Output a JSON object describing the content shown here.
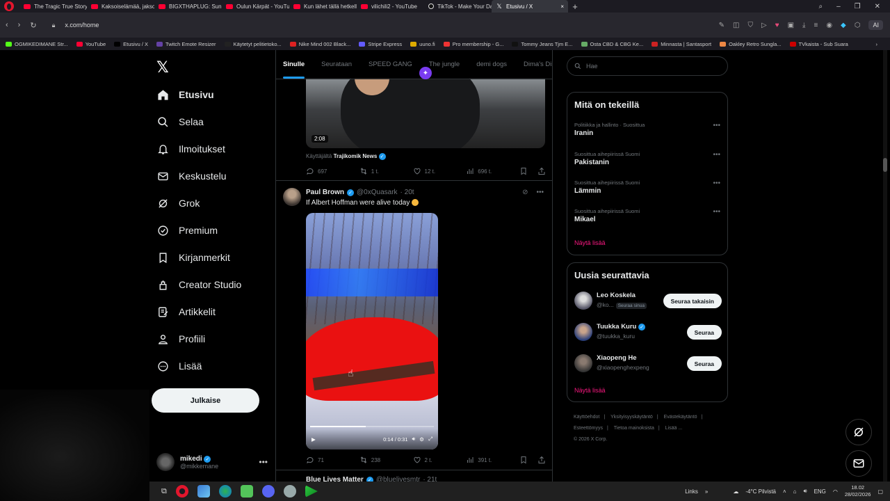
{
  "browser": {
    "tabs": [
      {
        "label": "The Tragic True Story of Ju",
        "icon": "youtube-icon"
      },
      {
        "label": "Kaksoiselämää, jakso 4 - Y",
        "icon": "youtube-icon"
      },
      {
        "label": "BIGXTHAPLUG: Sundae C",
        "icon": "youtube-icon"
      },
      {
        "label": "Oulun Kärpät - YouTube",
        "icon": "youtube-icon"
      },
      {
        "label": "Kun lähet tällä hetkellä uli",
        "icon": "youtube-icon"
      },
      {
        "label": "vilichili2 - YouTube",
        "icon": "youtube-icon"
      },
      {
        "label": "TikTok - Make Your Day",
        "icon": "tiktok-icon"
      },
      {
        "label": "Etusivu / X",
        "icon": "x-icon",
        "active": true
      }
    ],
    "url": "x.com/home",
    "ai_button": "AI",
    "bookmarks": [
      {
        "label": "OGMIKEDIMANE Str...",
        "color": "#53fc18"
      },
      {
        "label": "YouTube",
        "color": "#ff0033"
      },
      {
        "label": "Etusivu / X",
        "color": "#000000"
      },
      {
        "label": "Twitch Emote Resizer",
        "color": "#6441a5"
      },
      {
        "label": "Käytetyt pelitietoko...",
        "color": "#222222"
      },
      {
        "label": "Nike Mind 002 Black...",
        "color": "#d22"
      },
      {
        "label": "Stripe Express",
        "color": "#635bff"
      },
      {
        "label": "uuno.fi",
        "color": "#ddaa00"
      },
      {
        "label": "Pro membership - G...",
        "color": "#e33"
      },
      {
        "label": "Tommy Jeans Tjm E...",
        "color": "#111"
      },
      {
        "label": "Osta CBD & CBG Ke...",
        "color": "#6a6"
      },
      {
        "label": "Minnasta | Santasport",
        "color": "#c22"
      },
      {
        "label": "Oakley Retro Sungla...",
        "color": "#e84"
      },
      {
        "label": "TVkaista - Sub Suara",
        "color": "#c00"
      }
    ]
  },
  "nav": {
    "items": [
      {
        "label": "Etusivu",
        "icon": "home-icon"
      },
      {
        "label": "Selaa",
        "icon": "search-icon"
      },
      {
        "label": "Ilmoitukset",
        "icon": "bell-icon"
      },
      {
        "label": "Keskustelu",
        "icon": "mail-icon"
      },
      {
        "label": "Grok",
        "icon": "grok-icon"
      },
      {
        "label": "Premium",
        "icon": "premium-icon"
      },
      {
        "label": "Kirjanmerkit",
        "icon": "bookmark-icon"
      },
      {
        "label": "Creator Studio",
        "icon": "creator-studio-icon"
      },
      {
        "label": "Artikkelit",
        "icon": "article-icon"
      },
      {
        "label": "Profiili",
        "icon": "profile-icon"
      },
      {
        "label": "Lisää",
        "icon": "more-icon"
      }
    ],
    "post_button": "Julkaise",
    "account": {
      "name": "mikedi",
      "handle": "@mikkemane"
    }
  },
  "feed": {
    "tabs": [
      "Sinulle",
      "Seurataan",
      "SPEED GANG",
      "The jungle",
      "demi dogs",
      "Dima's Dist"
    ],
    "post1": {
      "duration": "2:08",
      "caption_prefix": "Käyttäjältä",
      "caption_source": "Trajikomik News",
      "replies": "697",
      "reposts": "1 t.",
      "likes": "12 t.",
      "views": "696 t."
    },
    "post2": {
      "author": "Paul Brown",
      "handle": "@0xQuasark",
      "time": "· 20t",
      "text": "If Albert Hoffman were alive today",
      "video_time": "0:14 / 0:31",
      "progress": 0.45,
      "replies": "71",
      "reposts": "238",
      "likes": "2 t.",
      "views": "391 t."
    },
    "post3": {
      "author": "Blue Lives Matter",
      "handle": "@bluelivesmtr",
      "time": "· 21t"
    }
  },
  "right": {
    "search_placeholder": "Hae",
    "trending_title": "Mitä on tekeillä",
    "trends": [
      {
        "context": "Politiikka ja hallinto · Suosittua",
        "name": "Iranin"
      },
      {
        "context": "Suosittua aihepiirissä Suomi",
        "name": "Pakistanin"
      },
      {
        "context": "Suosittua aihepiirissä Suomi",
        "name": "Lämmin"
      },
      {
        "context": "Suosittua aihepiirissä Suomi",
        "name": "Mikael"
      }
    ],
    "show_more": "Näytä lisää",
    "follow_title": "Uusia seurattavia",
    "follows": [
      {
        "name": "Leo Koskela",
        "handle": "@ko...",
        "badge": "Seuraa sinua",
        "button": "Seuraa takaisin"
      },
      {
        "name": "Tuukka Kuru",
        "handle": "@tuukka_kuru",
        "badge": "",
        "button": "Seuraa"
      },
      {
        "name": "Xiaopeng He",
        "handle": "@xiaopenghexpeng",
        "badge": "",
        "button": "Seuraa"
      }
    ],
    "footer": [
      "Käyttöehdot",
      "Yksityisyyskäytäntö",
      "Evästekäytäntö",
      "Esteettömyys",
      "Tietoa mainoksista",
      "Lisää ...",
      "© 2026 X Corp."
    ]
  },
  "taskbar": {
    "links": "Links",
    "weather": "-4°C  Pilvistä",
    "lang": "ENG",
    "time": "18.02",
    "date": "28/02/2026"
  },
  "colors": {
    "accent": "#1d9bf0",
    "pink_link": "#f91880",
    "background": "#000000"
  }
}
